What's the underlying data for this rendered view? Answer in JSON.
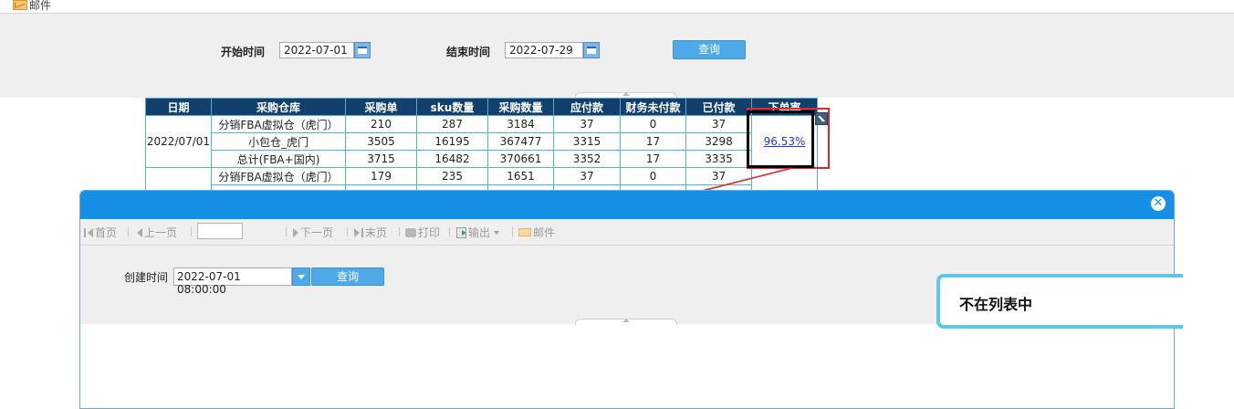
{
  "top": {
    "mail_label": "邮件"
  },
  "filter": {
    "start_label": "开始时间",
    "start_value": "2022-07-01",
    "end_label": "结束时间",
    "end_value": "2022-07-29",
    "query_label": "查询"
  },
  "table": {
    "headers": [
      "日期",
      "采购仓库",
      "采购单",
      "sku数量",
      "采购数量",
      "应付款",
      "财务未付款",
      "已付款",
      "下单率"
    ],
    "groups": [
      {
        "date": "2022/07/01",
        "rows": [
          [
            "分销FBA虚拟仓（虎门）",
            "210",
            "287",
            "3184",
            "37",
            "0",
            "37"
          ],
          [
            "小包仓_虎门",
            "3505",
            "16195",
            "367477",
            "3315",
            "17",
            "3298"
          ],
          [
            "总计(FBA+国内)",
            "3715",
            "16482",
            "370661",
            "3352",
            "17",
            "3335"
          ]
        ],
        "rate": "96.53%"
      },
      {
        "date": "",
        "rows": [
          [
            "分销FBA虚拟仓（虎门）",
            "179",
            "235",
            "1651",
            "37",
            "0",
            "37"
          ]
        ],
        "rate": ""
      }
    ]
  },
  "popup": {
    "pager": {
      "first": "首页",
      "prev": "上一页",
      "page_value": "",
      "next": "下一页",
      "last": "末页",
      "print": "打印",
      "export": "输出",
      "mail": "邮件"
    },
    "query": {
      "created_label": "创建时间",
      "created_value": "2022-07-01 08:00:00",
      "query_label": "查询"
    }
  },
  "callout": {
    "text": "不在列表中"
  },
  "colors": {
    "header_bg": "#10406b",
    "accent_blue": "#1690e5",
    "button_blue": "#4ea9e8",
    "annotation_red": "#e22727",
    "callout_border": "#5ec6e6"
  }
}
